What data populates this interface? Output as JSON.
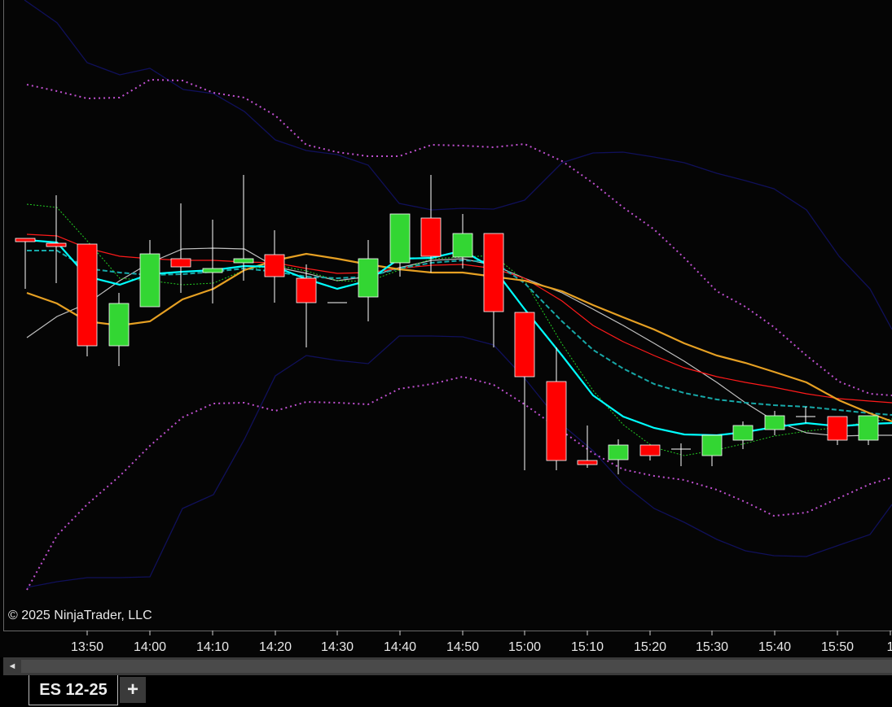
{
  "copyright": "© 2025 NinjaTrader, LLC",
  "tabs": {
    "instrument_label": "ES 12-25",
    "add_label": "+"
  },
  "scroll_left_glyph": "◄",
  "time_axis": [
    "13:50",
    "14:00",
    "14:10",
    "14:20",
    "14:30",
    "14:40",
    "14:50",
    "15:00",
    "15:10",
    "15:20",
    "15:30",
    "15:40",
    "15:50",
    "1"
  ],
  "colors": {
    "background": "#050505",
    "up_candle": "#33d633",
    "down_candle": "#ff0000",
    "wick": "#ffffff",
    "ema_fast": "#00ffff",
    "ema_slow": "#e6a023",
    "sma": "#c0c0c0",
    "ma_red": "#ff1a1a",
    "ma_teal_dashed": "#17a8a8",
    "ma_green_dotted": "#22cc22",
    "bollinger_outer": "#10105a",
    "bollinger_inner": "#c050d0"
  },
  "candles": [
    {
      "t": "13:45",
      "o": 297,
      "c": 293,
      "h": 293,
      "l": 355,
      "dir": "down"
    },
    {
      "t": "13:47",
      "o": 303,
      "c": 299,
      "h": 240,
      "l": 348,
      "dir": "down"
    },
    {
      "t": "13:50",
      "o": 300,
      "c": 425,
      "h": 300,
      "l": 438,
      "dir": "down"
    },
    {
      "t": "13:55",
      "o": 425,
      "c": 373,
      "h": 360,
      "l": 450,
      "dir": "up"
    },
    {
      "t": "14:00",
      "o": 377,
      "c": 312,
      "h": 295,
      "l": 377,
      "dir": "up"
    },
    {
      "t": "14:05",
      "o": 318,
      "c": 328,
      "h": 250,
      "l": 360,
      "dir": "down"
    },
    {
      "t": "14:10",
      "o": 335,
      "c": 330,
      "h": 270,
      "l": 373,
      "dir": "up"
    },
    {
      "t": "14:15",
      "o": 323,
      "c": 318,
      "h": 215,
      "l": 345,
      "dir": "up"
    },
    {
      "t": "14:20",
      "o": 313,
      "c": 340,
      "h": 283,
      "l": 372,
      "dir": "down"
    },
    {
      "t": "14:25",
      "o": 342,
      "c": 372,
      "h": 325,
      "l": 427,
      "dir": "down"
    },
    {
      "t": "14:30",
      "o": 372,
      "c": 372,
      "h": 372,
      "l": 372,
      "dir": "doji"
    },
    {
      "t": "14:35",
      "o": 365,
      "c": 318,
      "h": 295,
      "l": 395,
      "dir": "up"
    },
    {
      "t": "14:40",
      "o": 323,
      "c": 263,
      "h": 263,
      "l": 340,
      "dir": "up"
    },
    {
      "t": "14:45",
      "o": 268,
      "c": 315,
      "h": 215,
      "l": 335,
      "dir": "down"
    },
    {
      "t": "14:50",
      "o": 316,
      "c": 287,
      "h": 263,
      "l": 330,
      "dir": "up"
    },
    {
      "t": "14:55",
      "o": 287,
      "c": 383,
      "h": 287,
      "l": 427,
      "dir": "down"
    },
    {
      "t": "15:00",
      "o": 384,
      "c": 463,
      "h": 384,
      "l": 578,
      "dir": "down"
    },
    {
      "t": "15:05",
      "o": 469,
      "c": 566,
      "h": 427,
      "l": 578,
      "dir": "down"
    },
    {
      "t": "15:10",
      "o": 566,
      "c": 571,
      "h": 523,
      "l": 575,
      "dir": "down"
    },
    {
      "t": "15:15",
      "o": 565,
      "c": 547,
      "h": 540,
      "l": 583,
      "dir": "up"
    },
    {
      "t": "15:20",
      "o": 547,
      "c": 560,
      "h": 547,
      "l": 566,
      "dir": "down"
    },
    {
      "t": "15:25",
      "o": 552,
      "c": 552,
      "h": 545,
      "l": 573,
      "dir": "doji"
    },
    {
      "t": "15:30",
      "o": 560,
      "c": 535,
      "h": 535,
      "l": 573,
      "dir": "up"
    },
    {
      "t": "15:35",
      "o": 541,
      "c": 523,
      "h": 518,
      "l": 552,
      "dir": "up"
    },
    {
      "t": "15:40",
      "o": 528,
      "c": 511,
      "h": 505,
      "l": 535,
      "dir": "up"
    },
    {
      "t": "15:45",
      "o": 512,
      "c": 512,
      "h": 500,
      "l": 520,
      "dir": "doji"
    },
    {
      "t": "15:50",
      "o": 512,
      "c": 541,
      "h": 512,
      "l": 547,
      "dir": "down"
    },
    {
      "t": "15:55",
      "o": 541,
      "c": 511,
      "h": 511,
      "l": 547,
      "dir": "up"
    }
  ]
}
